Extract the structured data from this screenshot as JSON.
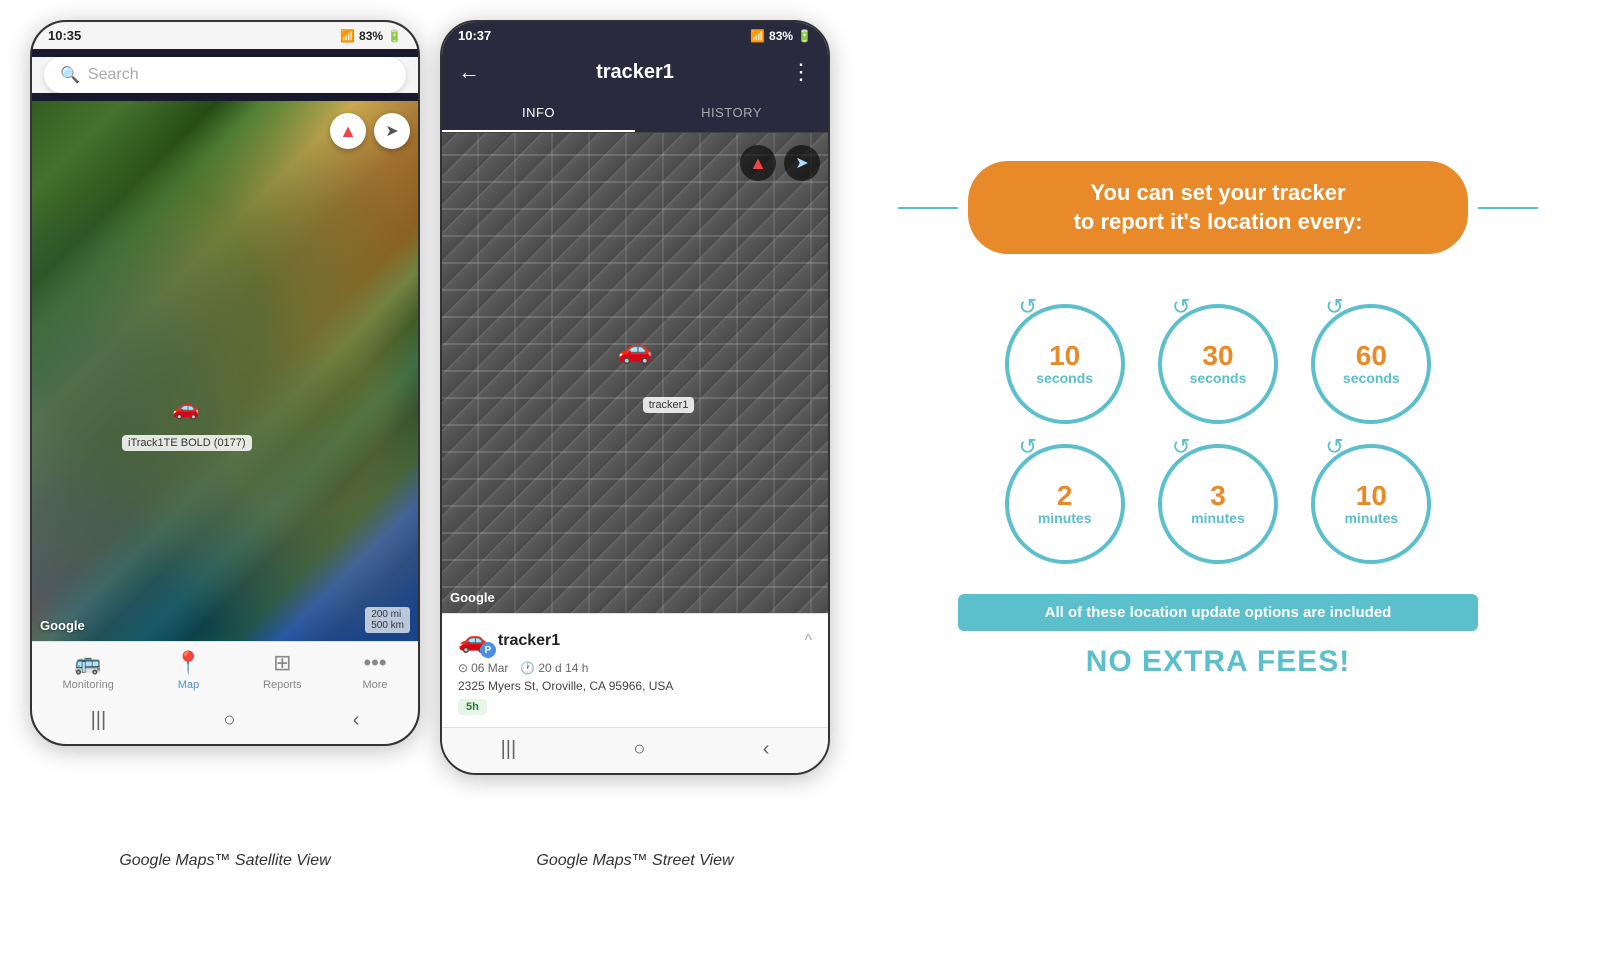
{
  "phone1": {
    "status_time": "10:35",
    "status_signal": "📶",
    "status_battery": "83%",
    "search_placeholder": "Search",
    "compass_icon": "⬆",
    "navigate_icon": "➤",
    "tracker_label": "iTrack1TE BOLD (0177)",
    "tracker_pin": "🚗",
    "google_label": "Google",
    "scale_label": "200 mi\n500 km",
    "nav_items": [
      {
        "label": "Monitoring",
        "icon": "🚌",
        "active": false
      },
      {
        "label": "Map",
        "icon": "📍",
        "active": true
      },
      {
        "label": "Reports",
        "icon": "⊞",
        "active": false
      },
      {
        "label": "More",
        "icon": "•••",
        "active": false
      }
    ],
    "android_buttons": [
      "|||",
      "○",
      "<"
    ]
  },
  "phone2": {
    "status_time": "10:37",
    "status_battery": "83%",
    "header_title": "tracker1",
    "header_back": "←",
    "header_menu": "⋮",
    "tab_info": "INFO",
    "tab_history": "HISTORY",
    "google_label": "Google",
    "tracker_pin": "🚗",
    "tracker_label": "tracker1",
    "info_name": "tracker1",
    "info_date": "06 Mar",
    "info_duration": "20 d 14 h",
    "info_address": "2325 Myers St, Oroville, CA 95966, USA",
    "info_tag": "5h",
    "android_buttons": [
      "|||",
      "○",
      "<"
    ]
  },
  "captions": {
    "phone1": "Google Maps™ Satellite View",
    "phone2": "Google Maps™ Street View"
  },
  "tracker_card": {
    "title_line1": "You can set your tracker",
    "title_line2": "to report it's location every:",
    "intervals": [
      {
        "number": "10",
        "unit": "seconds"
      },
      {
        "number": "30",
        "unit": "seconds"
      },
      {
        "number": "60",
        "unit": "seconds"
      },
      {
        "number": "2",
        "unit": "minutes"
      },
      {
        "number": "3",
        "unit": "minutes"
      },
      {
        "number": "10",
        "unit": "minutes"
      }
    ],
    "no_fees_text": "All of these location update options are included",
    "extra_fees_label": "NO EXTRA FEES!"
  }
}
